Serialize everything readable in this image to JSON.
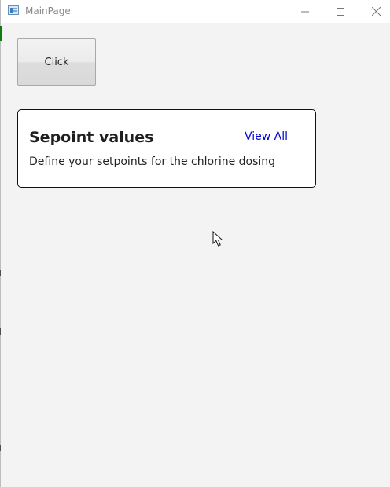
{
  "window": {
    "title": "MainPage",
    "controls": {
      "minimize": "minimize-icon",
      "maximize": "maximize-icon",
      "close": "close-icon"
    }
  },
  "main": {
    "click_button_label": "Click",
    "card": {
      "title": "Sepoint values",
      "link_label": "View All",
      "description": "Define your setpoints for the chlorine dosing"
    }
  },
  "colors": {
    "background": "#f3f3f3",
    "title_bar": "#ffffff",
    "link": "#0000d8",
    "card_border": "#111111",
    "accent": "#107c10"
  },
  "icons": {
    "app": "app-window-icon",
    "cursor": "mouse-pointer-icon"
  }
}
